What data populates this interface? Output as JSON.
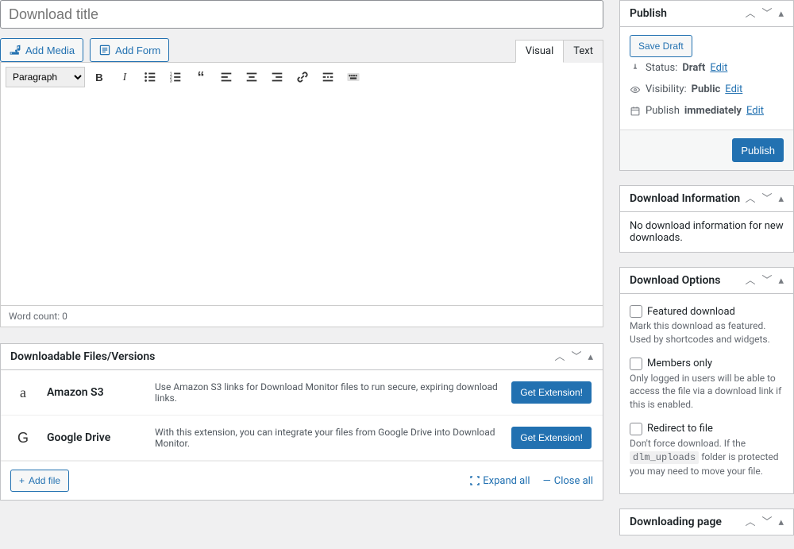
{
  "title_placeholder": "Download title",
  "media_buttons": {
    "add_media": "Add Media",
    "add_form": "Add Form"
  },
  "editor": {
    "tabs": {
      "visual": "Visual",
      "text": "Text"
    },
    "format_select": "Paragraph",
    "word_count": "Word count: 0"
  },
  "files_box": {
    "title": "Downloadable Files/Versions",
    "extensions": [
      {
        "icon": "a",
        "name": "Amazon S3",
        "desc": "Use Amazon S3 links for Download Monitor files to run secure, expiring download links.",
        "button": "Get Extension!"
      },
      {
        "icon": "G",
        "name": "Google Drive",
        "desc": "With this extension, you can integrate your files from Google Drive into Download Monitor.",
        "button": "Get Extension!"
      }
    ],
    "add_file": "Add file",
    "expand_all": "Expand all",
    "close_all": "Close all"
  },
  "publish": {
    "title": "Publish",
    "save_draft": "Save Draft",
    "status_label": "Status:",
    "status_value": "Draft",
    "visibility_label": "Visibility:",
    "visibility_value": "Public",
    "publish_label": "Publish",
    "publish_value": "immediately",
    "edit": "Edit",
    "publish_button": "Publish"
  },
  "download_info": {
    "title": "Download Information",
    "text": "No download information for new downloads."
  },
  "download_options": {
    "title": "Download Options",
    "featured": {
      "label": "Featured download",
      "desc": "Mark this download as featured. Used by shortcodes and widgets."
    },
    "members": {
      "label": "Members only",
      "desc": "Only logged in users will be able to access the file via a download link if this is enabled."
    },
    "redirect": {
      "label": "Redirect to file",
      "desc_pre": "Don't force download. If the ",
      "code": "dlm_uploads",
      "desc_post": " folder is protected you may need to move your file."
    }
  },
  "downloading_page": {
    "title": "Downloading page"
  }
}
